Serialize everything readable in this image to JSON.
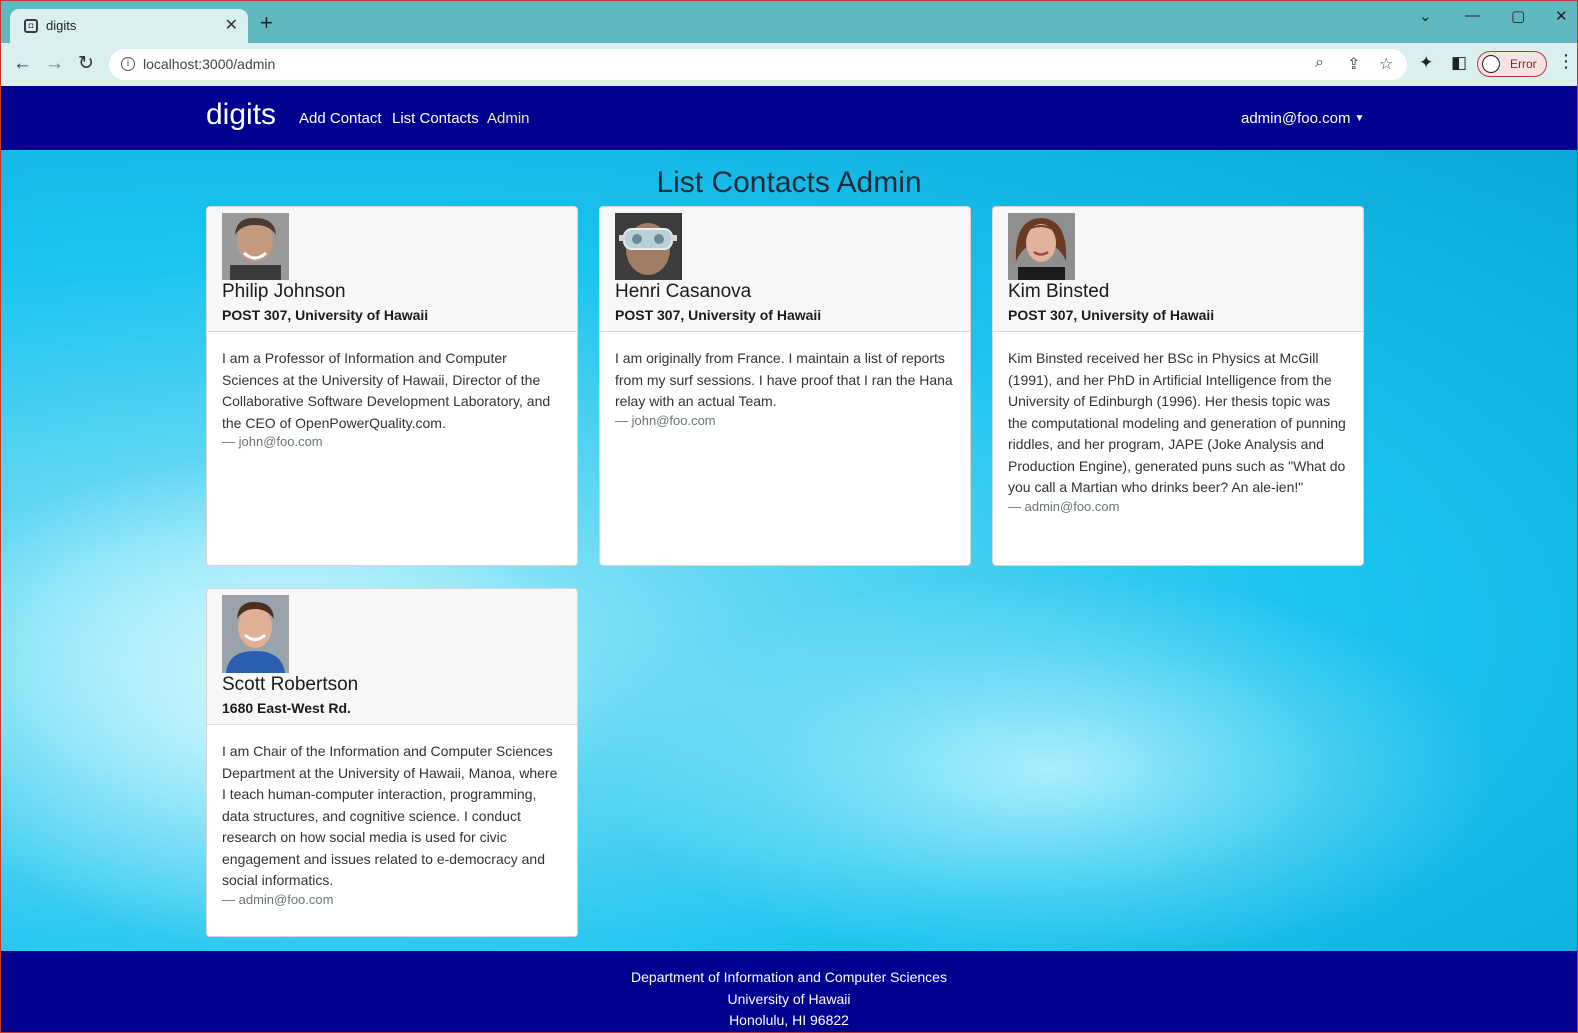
{
  "browser": {
    "tab_title": "digits",
    "url": "localhost:3000/admin",
    "profile_status": "Error"
  },
  "navbar": {
    "brand": "digits",
    "links": [
      "Add Contact",
      "List Contacts",
      "Admin"
    ],
    "active_link": "Admin",
    "user": "admin@foo.com"
  },
  "page": {
    "title": "List Contacts Admin"
  },
  "contacts": [
    {
      "name": "Philip Johnson",
      "address": "POST 307, University of Hawaii",
      "description": "I am a Professor of Information and Computer Sciences at the University of Hawaii, Director of the Collaborative Software Development Laboratory, and the CEO of OpenPowerQuality.com.",
      "owner": "— john@foo.com"
    },
    {
      "name": "Henri Casanova",
      "address": "POST 307, University of Hawaii",
      "description": "I am originally from France. I maintain a list of reports from my surf sessions. I have proof that I ran the Hana relay with an actual Team.",
      "owner": "— john@foo.com"
    },
    {
      "name": "Kim Binsted",
      "address": "POST 307, University of Hawaii",
      "description": "Kim Binsted received her BSc in Physics at McGill (1991), and her PhD in Artificial Intelligence from the University of Edinburgh (1996). Her thesis topic was the computational modeling and generation of punning riddles, and her program, JAPE (Joke Analysis and Production Engine), generated puns such as \"What do you call a Martian who drinks beer? An ale-ien!\"",
      "owner": "— admin@foo.com"
    },
    {
      "name": "Scott Robertson",
      "address": "1680 East-West Rd.",
      "description": "I am Chair of the Information and Computer Sciences Department at the University of Hawaii, Manoa, where I teach human-computer interaction, programming, data structures, and cognitive science. I conduct research on how social media is used for civic engagement and issues related to e-democracy and social informatics.",
      "owner": "— admin@foo.com"
    }
  ],
  "footer": {
    "lines": [
      "Department of Information and Computer Sciences",
      "University of Hawaii",
      "Honolulu, HI 96822"
    ]
  }
}
